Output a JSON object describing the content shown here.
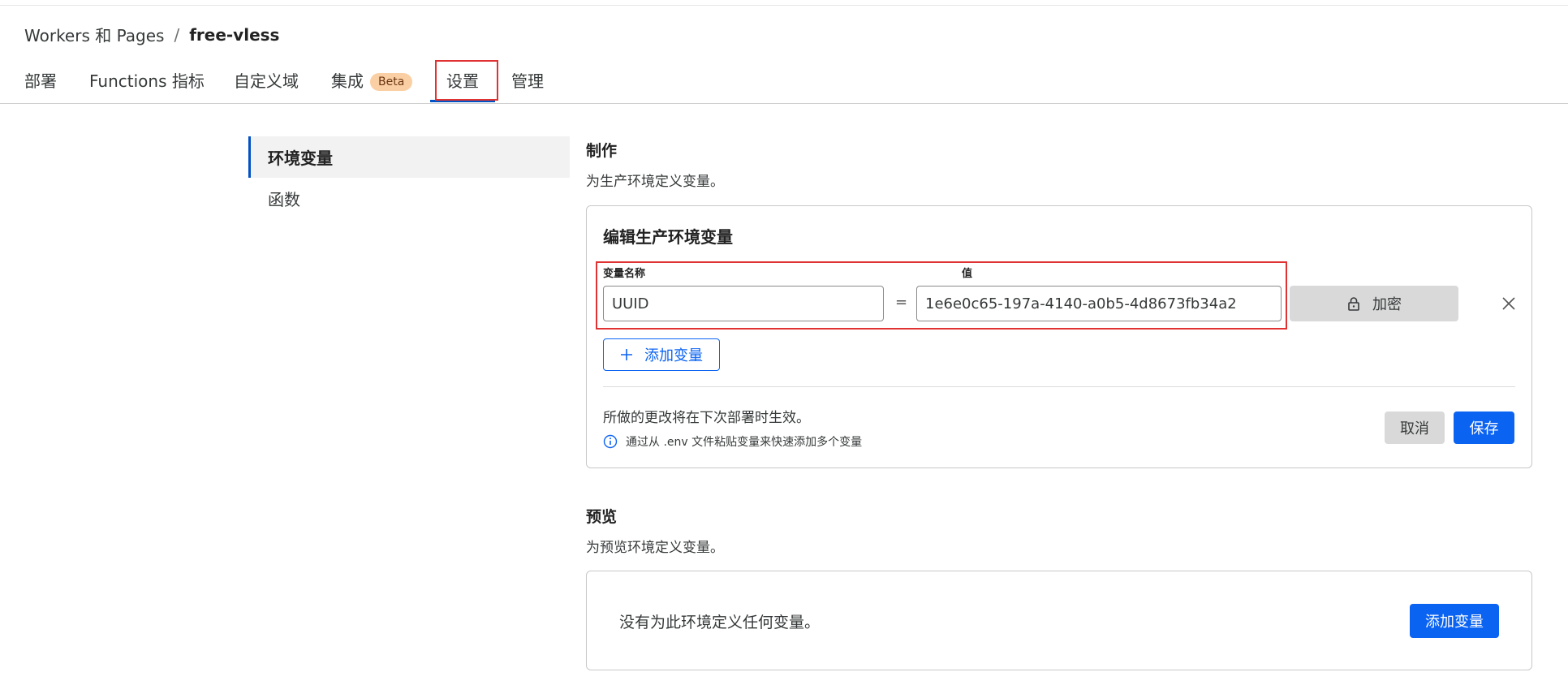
{
  "breadcrumb": {
    "parent": "Workers 和 Pages",
    "separator": "/",
    "current": "free-vless"
  },
  "tabs": [
    {
      "label": "部署"
    },
    {
      "label": "Functions 指标"
    },
    {
      "label": "自定义域"
    },
    {
      "label": "集成",
      "badge": "Beta"
    },
    {
      "label": "设置",
      "active": true
    },
    {
      "label": "管理"
    }
  ],
  "sidebar": {
    "items": [
      {
        "label": "环境变量",
        "active": true
      },
      {
        "label": "函数"
      }
    ]
  },
  "production": {
    "title": "制作",
    "description": "为生产环境定义变量。",
    "editor": {
      "title": "编辑生产环境变量",
      "name_label": "变量名称",
      "value_label": "值",
      "name_value": "UUID",
      "equals": "=",
      "value_value": "1e6e0c65-197a-4140-a0b5-4d8673fb34a2",
      "encrypt_label": "加密",
      "add_variable_label": "添加变量",
      "note": "所做的更改将在下次部署时生效。",
      "hint": "通过从 .env 文件粘贴变量来快速添加多个变量",
      "cancel_label": "取消",
      "save_label": "保存"
    }
  },
  "preview": {
    "title": "预览",
    "description": "为预览环境定义变量。",
    "empty_text": "没有为此环境定义任何变量。",
    "add_variable_label": "添加变量"
  },
  "colors": {
    "accent": "#0b63f2",
    "active_tab_underline": "#0051c3",
    "highlight_box": "#e03232",
    "beta_badge": "#fbcfa4"
  }
}
